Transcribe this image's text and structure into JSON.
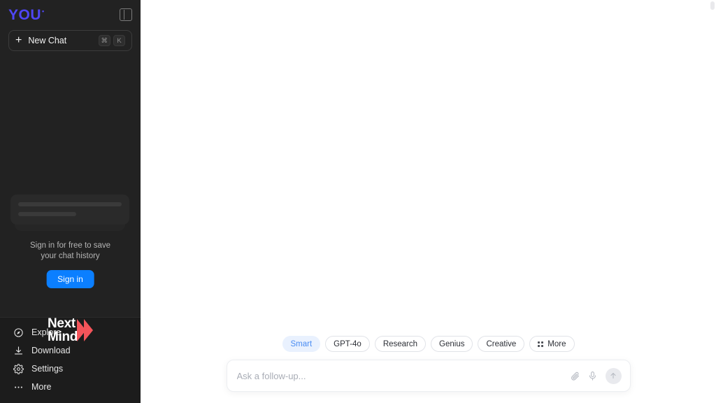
{
  "theme": {
    "sidebar_bg": "#222222",
    "sidebar_bottom_bg": "#1c1c1c",
    "main_bg": "#ffffff",
    "brand_logo_color": "#4f46f5",
    "signin_button_color": "#0b7fff",
    "active_chip_bg": "#e9f1fe",
    "active_chip_text": "#4a8df3",
    "nextmind_chevron_color": "#f4545a"
  },
  "sidebar": {
    "logo": {
      "text": "YOU",
      "superscript": "•"
    },
    "panel_toggle_icon": "sidebar-toggle-icon",
    "new_chat": {
      "label": "New Chat",
      "plus_icon": "plus-icon",
      "shortcut_modifier": "⌘",
      "shortcut_key": "K"
    },
    "signin_prompt": {
      "line1": "Sign in for free to save",
      "line2": "your chat history",
      "button_label": "Sign in"
    },
    "watermark": {
      "line1": "Next",
      "line2": "Mind"
    },
    "nav_items": [
      {
        "label": "Explore",
        "icon": "compass-icon"
      },
      {
        "label": "Download",
        "icon": "download-icon"
      },
      {
        "label": "Settings",
        "icon": "gear-icon"
      },
      {
        "label": "More",
        "icon": "ellipsis-icon"
      }
    ]
  },
  "main": {
    "model_chips": [
      {
        "label": "Smart",
        "active": true,
        "icon": null
      },
      {
        "label": "GPT-4o",
        "active": false,
        "icon": null
      },
      {
        "label": "Research",
        "active": false,
        "icon": null
      },
      {
        "label": "Genius",
        "active": false,
        "icon": null
      },
      {
        "label": "Creative",
        "active": false,
        "icon": null
      },
      {
        "label": "More",
        "active": false,
        "icon": "grid-icon"
      }
    ],
    "composer": {
      "placeholder": "Ask a follow-up...",
      "value": "",
      "attach_icon": "paperclip-icon",
      "mic_icon": "microphone-icon",
      "send_icon": "arrow-up-icon"
    }
  }
}
